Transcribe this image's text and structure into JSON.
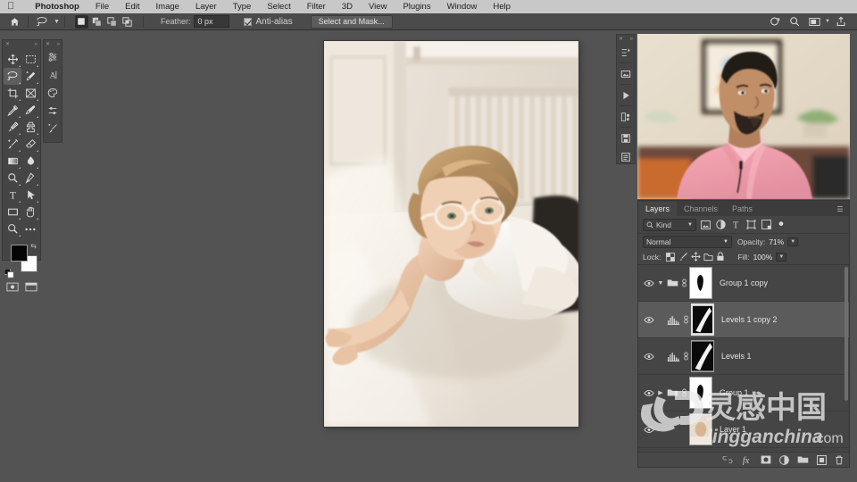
{
  "app": {
    "name": "Photoshop"
  },
  "menubar": {
    "apple_icon": "apple-logo-icon",
    "items": [
      {
        "label": "Photoshop",
        "bold": true
      },
      {
        "label": "File",
        "bold": false
      },
      {
        "label": "Edit",
        "bold": false
      },
      {
        "label": "Image",
        "bold": false
      },
      {
        "label": "Layer",
        "bold": false
      },
      {
        "label": "Type",
        "bold": false
      },
      {
        "label": "Select",
        "bold": false
      },
      {
        "label": "Filter",
        "bold": false
      },
      {
        "label": "3D",
        "bold": false
      },
      {
        "label": "View",
        "bold": false
      },
      {
        "label": "Plugins",
        "bold": false
      },
      {
        "label": "Window",
        "bold": false
      },
      {
        "label": "Help",
        "bold": false
      }
    ]
  },
  "options_bar": {
    "home_icon": "home-icon",
    "tool_icon": "lasso-tool-icon",
    "tool_preset_chevron": "chevron-down-icon",
    "selection_modes": [
      {
        "name": "new-selection",
        "active": true
      },
      {
        "name": "add-to-selection",
        "active": false
      },
      {
        "name": "subtract-from-selection",
        "active": false
      },
      {
        "name": "intersect-with-selection",
        "active": false
      }
    ],
    "feather_label": "Feather:",
    "feather_value": "0 px",
    "antialias_label": "Anti-alias",
    "antialias_checked": true,
    "select_and_mask_label": "Select and Mask...",
    "right_icons": [
      "share-cloud-icon",
      "search-icon",
      "workspace-icon",
      "chevron-down-icon",
      "export-icon"
    ]
  },
  "toolbar": {
    "grip_left": "close-icon",
    "grip_right": "collapse-icon",
    "tools": [
      {
        "name": "move-tool",
        "selected": false
      },
      {
        "name": "rectangular-marquee-tool",
        "selected": false
      },
      {
        "name": "lasso-tool",
        "selected": true
      },
      {
        "name": "quick-selection-tool",
        "selected": false
      },
      {
        "name": "crop-tool",
        "selected": false
      },
      {
        "name": "frame-tool",
        "selected": false
      },
      {
        "name": "eyedropper-tool",
        "selected": false
      },
      {
        "name": "spot-healing-brush-tool",
        "selected": false
      },
      {
        "name": "brush-tool",
        "selected": false
      },
      {
        "name": "clone-stamp-tool",
        "selected": false
      },
      {
        "name": "history-brush-tool",
        "selected": false
      },
      {
        "name": "eraser-tool",
        "selected": false
      },
      {
        "name": "gradient-tool",
        "selected": false
      },
      {
        "name": "blur-tool",
        "selected": false
      },
      {
        "name": "dodge-tool",
        "selected": false
      },
      {
        "name": "pen-tool",
        "selected": false
      },
      {
        "name": "type-tool",
        "selected": false
      },
      {
        "name": "path-selection-tool",
        "selected": false
      },
      {
        "name": "rectangle-tool",
        "selected": false
      },
      {
        "name": "hand-tool",
        "selected": false
      },
      {
        "name": "zoom-tool",
        "selected": false
      },
      {
        "name": "edit-toolbar-tool",
        "selected": false
      }
    ],
    "foreground_color": "#050505",
    "background_color": "#ffffff",
    "swap_icon": "swap-colors-icon",
    "default_icon": "default-colors-icon",
    "quick_mask_icon": "quick-mask-icon",
    "screen_mode_icon": "screen-mode-icon"
  },
  "left_dock": {
    "items": [
      {
        "name": "adjustments-panel-icon"
      },
      {
        "name": "character-panel-icon"
      },
      {
        "name": "swatches-panel-icon"
      },
      {
        "name": "properties-panel-icon"
      },
      {
        "name": "brush-settings-panel-icon"
      }
    ]
  },
  "right_dock": {
    "items": [
      {
        "name": "history-panel-icon"
      },
      {
        "name": "libraries-panel-icon"
      },
      {
        "name": "actions-panel-icon"
      },
      {
        "name": "channels-panel-icon"
      },
      {
        "name": "notes-panel-icon"
      },
      {
        "name": "paragraph-panel-icon"
      }
    ]
  },
  "canvas": {
    "cursor": "lasso-cursor",
    "document_name": ""
  },
  "video_overlay": {
    "name": "instructor-video",
    "collapse_icon": "collapse-icon"
  },
  "layers_panel": {
    "tabs": [
      {
        "label": "Layers",
        "active": true
      },
      {
        "label": "Channels",
        "active": false
      },
      {
        "label": "Paths",
        "active": false
      }
    ],
    "menu_icon": "panel-menu-icon",
    "filter": {
      "search_icon": "search-icon",
      "kind_label": "Kind",
      "chevron": "chevron-down-icon",
      "type_icons": [
        "pixel-filter-icon",
        "adjustment-filter-icon",
        "type-filter-icon",
        "shape-filter-icon",
        "smart-object-filter-icon"
      ],
      "toggle_icon": "filter-toggle-icon"
    },
    "blend_mode": "Normal",
    "blend_chevron": "chevron-down-icon",
    "opacity_label": "Opacity:",
    "opacity_value": "71%",
    "lock_label": "Lock:",
    "lock_icons": [
      "lock-transparent-pixels-icon",
      "lock-image-pixels-icon",
      "lock-position-icon",
      "lock-artboard-nesting-icon",
      "lock-all-icon"
    ],
    "fill_label": "Fill:",
    "fill_value": "100%",
    "layers": [
      {
        "name": "Group 1 copy",
        "type": "group",
        "visible": true,
        "selected": false,
        "expanded": true,
        "has_mask": true,
        "mask_linked": true,
        "thumb": "mask-white-brush"
      },
      {
        "name": "Levels 1 copy 2",
        "type": "adjustment-levels",
        "visible": true,
        "selected": true,
        "has_mask": true,
        "mask_linked": true,
        "thumb": "mask-black-stroke"
      },
      {
        "name": "Levels 1",
        "type": "adjustment-levels",
        "visible": true,
        "selected": false,
        "has_mask": true,
        "mask_linked": true,
        "thumb": "mask-black-stroke"
      },
      {
        "name": "Group 1",
        "type": "group",
        "visible": true,
        "selected": false,
        "expanded": false,
        "has_mask": true,
        "mask_linked": true,
        "thumb": "mask-white-brush"
      },
      {
        "name": "Layer 1",
        "type": "pixel",
        "visible": true,
        "selected": false,
        "has_mask": false,
        "thumb": "photo"
      }
    ],
    "bottom_icons": [
      "link-layers-icon",
      "layer-style-icon",
      "add-layer-mask-icon",
      "new-adjustment-layer-icon",
      "new-group-icon",
      "new-layer-icon",
      "delete-layer-icon"
    ]
  },
  "watermark": {
    "cn_text": "灵感中国",
    "domain_text": "lingganchina",
    "tld_text": ".com"
  },
  "colors": {
    "panel_bg": "#454545",
    "app_bg": "#535353",
    "menubar_bg": "#c8c8c8",
    "selected_row": "#5b5b5b",
    "text": "#d4d4d4"
  }
}
